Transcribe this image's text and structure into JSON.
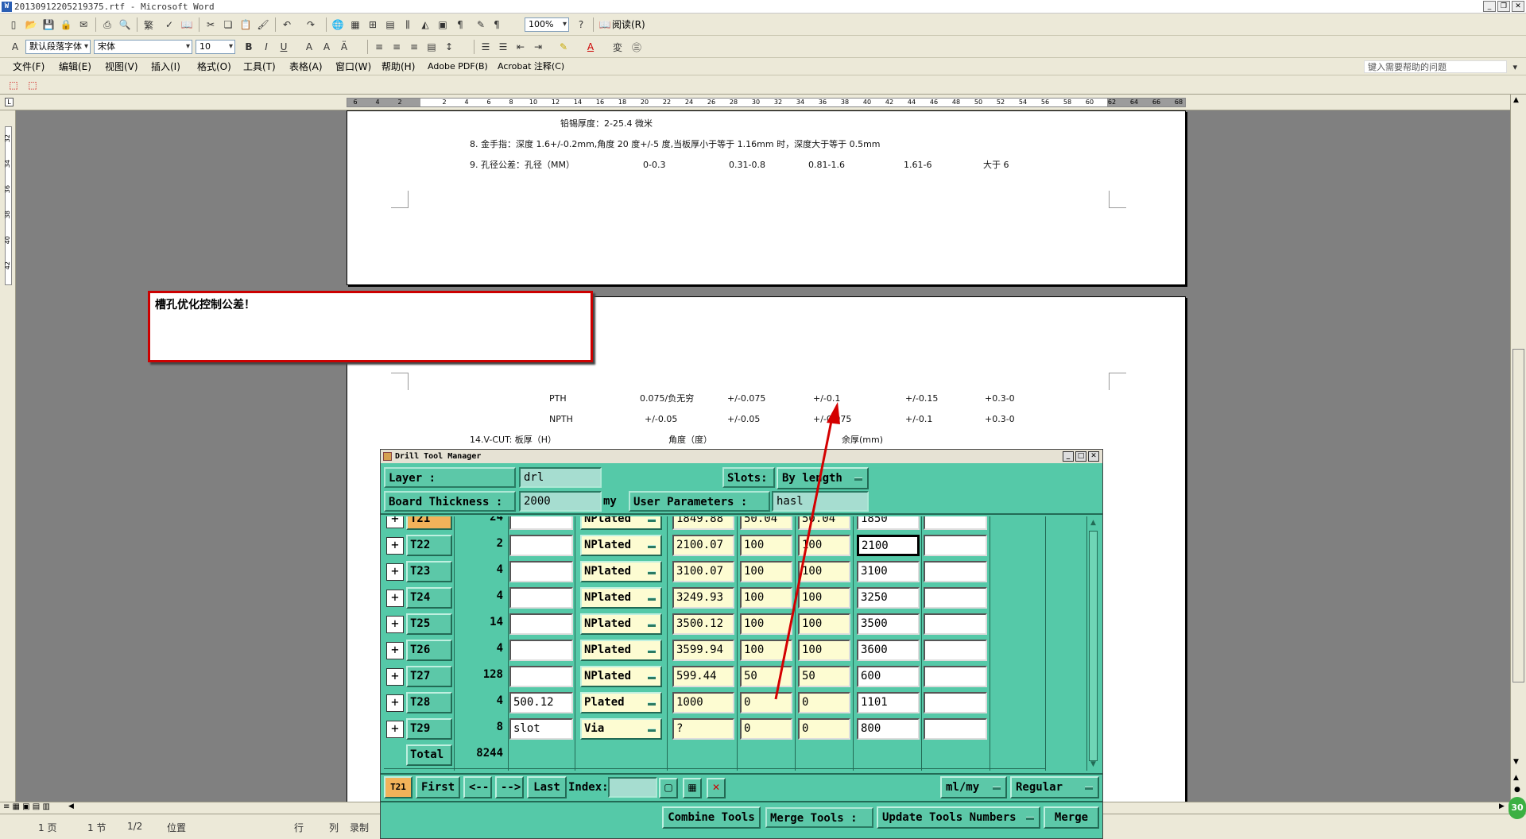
{
  "window": {
    "title": "20130912205219375.rtf - Microsoft Word"
  },
  "toolbar": {
    "zoom": "100%",
    "read_label": "阅读(R)",
    "style": "默认段落字体",
    "font": "宋体",
    "size": "10"
  },
  "menu": {
    "items": [
      "文件(F)",
      "编辑(E)",
      "视图(V)",
      "插入(I)",
      "格式(O)",
      "工具(T)",
      "表格(A)",
      "窗口(W)",
      "帮助(H)",
      "Adobe PDF(B)",
      "Acrobat 注释(C)"
    ],
    "help_placeholder": "键入需要帮助的问题"
  },
  "ruler": {
    "ticks": [
      "6",
      "4",
      "2",
      "",
      "2",
      "4",
      "6",
      "8",
      "10",
      "12",
      "14",
      "16",
      "18",
      "20",
      "22",
      "24",
      "26",
      "28",
      "30",
      "32",
      "34",
      "36",
      "38",
      "40",
      "42",
      "44",
      "46",
      "48",
      "50",
      "52",
      "54",
      "56",
      "58",
      "60",
      "62",
      "64",
      "66",
      "68"
    ],
    "vticks": [
      "32",
      "34",
      "36",
      "38",
      "40",
      "42"
    ]
  },
  "document": {
    "page1": {
      "line1": "铅锡厚度：2-25.4 微米",
      "line2": "8.  金手指：深度 1.6+/-0.2mm,角度 20 度+/-5 度,当板厚小于等于 1.16mm 时，深度大于等于 0.5mm",
      "line3": [
        "9.  孔径公差：孔径（MM）",
        "0-0.3",
        "0.31-0.8",
        "0.81-1.6",
        "1.61-6",
        "大于 6"
      ]
    },
    "page2": {
      "pth": [
        "PTH",
        "0.075/负无穷",
        "+/-0.075",
        "+/-0.1",
        "+/-0.15",
        "+0.3-0"
      ],
      "npth": [
        "NPTH",
        "+/-0.05",
        "+/-0.05",
        "+/-0.075",
        "+/-0.1",
        "+0.3-0"
      ],
      "vcut": [
        "14.V-CUT:  板厚（H）",
        "角度（度）",
        "余厚(mm)"
      ]
    }
  },
  "comment": {
    "text": "槽孔优化控制公差！"
  },
  "drill_tool_manager": {
    "title": "Drill Tool Manager",
    "layer_label": "Layer          :",
    "layer_value": "drl",
    "slots_label": "Slots:",
    "slots_value": "By length",
    "board_label": "Board Thickness :",
    "board_value": "2000",
    "board_unit": "my",
    "user_params_label": "User Parameters :",
    "user_params_value": "hasl",
    "rows": [
      {
        "tool": "T21",
        "count": "24",
        "w": "",
        "type": "NPlated",
        "a": "1849.88",
        "b": "50.04",
        "c": "50.04",
        "d": "1850",
        "e": ""
      },
      {
        "tool": "T22",
        "count": "2",
        "w": "",
        "type": "NPlated",
        "a": "2100.07",
        "b": "100",
        "c": "100",
        "d": "2100",
        "e": ""
      },
      {
        "tool": "T23",
        "count": "4",
        "w": "",
        "type": "NPlated",
        "a": "3100.07",
        "b": "100",
        "c": "100",
        "d": "3100",
        "e": ""
      },
      {
        "tool": "T24",
        "count": "4",
        "w": "",
        "type": "NPlated",
        "a": "3249.93",
        "b": "100",
        "c": "100",
        "d": "3250",
        "e": ""
      },
      {
        "tool": "T25",
        "count": "14",
        "w": "",
        "type": "NPlated",
        "a": "3500.12",
        "b": "100",
        "c": "100",
        "d": "3500",
        "e": ""
      },
      {
        "tool": "T26",
        "count": "4",
        "w": "",
        "type": "NPlated",
        "a": "3599.94",
        "b": "100",
        "c": "100",
        "d": "3600",
        "e": ""
      },
      {
        "tool": "T27",
        "count": "128",
        "w": "",
        "type": "NPlated",
        "a": "599.44",
        "b": "50",
        "c": "50",
        "d": "600",
        "e": ""
      },
      {
        "tool": "T28",
        "count": "4",
        "w": "500.12",
        "type": "Plated",
        "a": "1000",
        "b": "0",
        "c": "0",
        "d": "1101",
        "e": ""
      },
      {
        "tool": "T29",
        "count": "8",
        "w": "slot",
        "type": "Via",
        "a": "?",
        "b": "0",
        "c": "0",
        "d": "800",
        "e": ""
      }
    ],
    "total_label": "Total",
    "total_value": "8244",
    "current_tool": "T21",
    "first_label": "First",
    "prev_label": "<--",
    "next_label": "-->",
    "last_label": "Last",
    "index_label": "Index:",
    "units_value": "ml/my",
    "mode_value": "Regular",
    "combine_label": "Combine Tools",
    "merge_tools_label": "Merge Tools :",
    "update_label": "Update Tools Numbers",
    "merge_label": "Merge"
  },
  "status": {
    "page": "1 页",
    "section": "1 节",
    "pages": "1/2",
    "position": "位置",
    "line": "行",
    "col": "列",
    "rec": "录制",
    "zoom_badge": "30"
  },
  "colors": {
    "dialog_bg": "#55c9a8",
    "comment_border": "#cc0000",
    "arrow": "#d40000",
    "selected_tool": "#f2b25a"
  }
}
